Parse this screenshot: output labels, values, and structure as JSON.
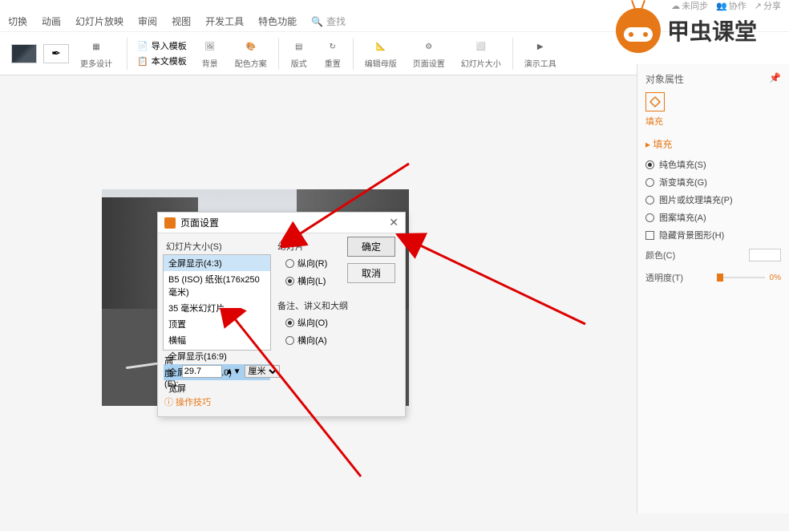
{
  "topbar": {
    "sync": "未同步",
    "collab": "协作",
    "share": "分享"
  },
  "menu": {
    "switch": "切换",
    "anim": "动画",
    "slideshow": "幻灯片放映",
    "review": "审阅",
    "view": "视图",
    "dev": "开发工具",
    "special": "特色功能",
    "search": "查找"
  },
  "ribbon": {
    "more_design": "更多设计",
    "import_tpl": "导入模板",
    "this_tpl": "本文模板",
    "background": "背景",
    "color_scheme": "配色方案",
    "format": "版式",
    "reset": "重置",
    "edit_master": "编辑母版",
    "page_setup": "页面设置",
    "slide_size": "幻灯片大小",
    "present_tools": "演示工具"
  },
  "brand": "甲虫课堂",
  "dialog": {
    "title": "页面设置",
    "size_label": "幻灯片大小(S)",
    "sizes": [
      "全屏显示(4:3)",
      "B5 (ISO) 纸张(176x250 毫米)",
      "35 毫米幻灯片",
      "顶置",
      "横幅",
      "全屏显示(16:9)",
      "全屏显示(16:10)",
      "宽屏"
    ],
    "height_label": "高度(E):",
    "height_value": "29.7",
    "height_unit": "厘米",
    "tips": "操作技巧",
    "orient1_title": "幻灯片",
    "orient_portrait": "纵向(R)",
    "orient_landscape": "横向(L)",
    "orient2_title": "备注、讲义和大纲",
    "orient_portrait2": "纵向(O)",
    "orient_landscape2": "横向(A)",
    "ok": "确定",
    "cancel": "取消"
  },
  "panel": {
    "title": "对象属性",
    "tab_fill": "填充",
    "section_fill": "填充",
    "opt_solid": "纯色填充(S)",
    "opt_gradient": "渐变填充(G)",
    "opt_texture": "图片或纹理填充(P)",
    "opt_pattern": "图案填充(A)",
    "opt_hidebg": "隐藏背景图形(H)",
    "color_label": "颜色(C)",
    "opacity_label": "透明度(T)",
    "opacity_value": "0%"
  }
}
